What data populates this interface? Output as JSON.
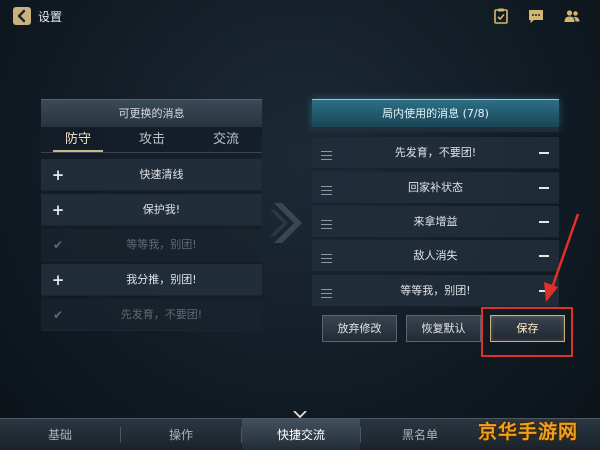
{
  "header": {
    "title": "设置",
    "icons": [
      "back-icon",
      "checklist-icon",
      "chat-icon",
      "friends-icon"
    ]
  },
  "left_panel": {
    "title": "可更换的消息",
    "tabs": [
      {
        "label": "防守",
        "active": true
      },
      {
        "label": "攻击",
        "active": false
      },
      {
        "label": "交流",
        "active": false
      }
    ],
    "items": [
      {
        "text": "快速清线",
        "icon": "plus-icon",
        "disabled": false
      },
      {
        "text": "保护我!",
        "icon": "plus-icon",
        "disabled": false
      },
      {
        "text": "等等我，别团!",
        "icon": "check-icon",
        "disabled": true
      },
      {
        "text": "我分推，别团!",
        "icon": "plus-icon",
        "disabled": false
      },
      {
        "text": "先发育，不要团!",
        "icon": "check-icon",
        "disabled": true
      }
    ]
  },
  "right_panel": {
    "title": "局内使用的消息 (7/8)",
    "items": [
      {
        "text": "先发育，不要团!"
      },
      {
        "text": "回家补状态"
      },
      {
        "text": "来拿增益"
      },
      {
        "text": "敌人消失"
      },
      {
        "text": "等等我，别团!"
      }
    ]
  },
  "actions": {
    "discard": "放弃修改",
    "restore": "恢复默认",
    "save": "保存"
  },
  "bottom_nav": [
    {
      "label": "基础",
      "active": false
    },
    {
      "label": "操作",
      "active": false
    },
    {
      "label": "快捷交流",
      "active": true
    },
    {
      "label": "黑名单",
      "active": false
    }
  ],
  "watermark": "京华手游网",
  "colors": {
    "accent_gold": "#c8b98a",
    "header_teal": "#2d6f86",
    "highlight_red": "#e0302a"
  }
}
